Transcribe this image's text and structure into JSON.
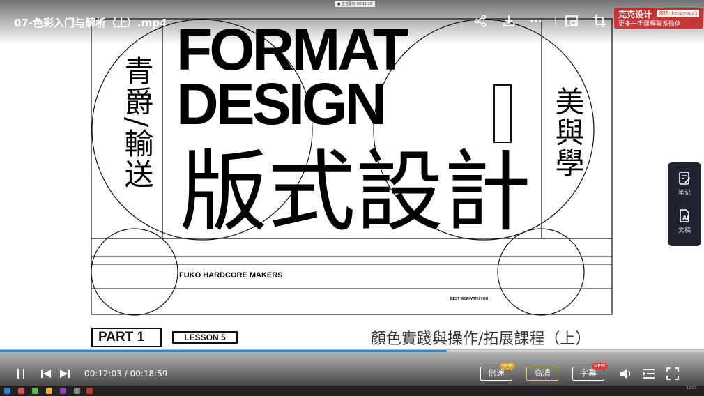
{
  "window": {
    "file_title": "07-色彩入门与解析（上）.mp4",
    "rec_tag": "● 正在录制 00:11:18"
  },
  "poster": {
    "title_line1": "FORMAT",
    "title_line2": "DESIGN",
    "left_vertical_text": "青爵/輸送",
    "right_vertical_text": "美與學",
    "big_chinese": "版式設計",
    "makers": "FUKO HARDCORE MAKERS",
    "wish": "BEST WISH WITH YOU",
    "part_label": "PART  1",
    "lesson_label": "LESSON  5",
    "subtitle": "顏色實踐與操作/拓展課程（上）"
  },
  "watermark": {
    "brand": "克克设计",
    "wechat": "微信: kekeyoya1",
    "slogan": "更多一手课程联系微信"
  },
  "top_icons": [
    "share-icon",
    "download-icon",
    "more-icon",
    "picture-in-picture-icon",
    "crop-icon",
    "minimize-icon",
    "maximize-icon",
    "close-icon"
  ],
  "side_panel": {
    "notes_label": "笔记",
    "transcript_label": "文稿"
  },
  "player": {
    "current_time": "00:12:03",
    "total_time": "00:18:59",
    "time_display": "00:12:03 / 00:18:59",
    "progress_fraction": 0.635,
    "speed_label": "倍速",
    "speed_badge": "SVIP",
    "quality_label": "高清",
    "subtitle_label": "字幕",
    "subtitle_badge": "NEW",
    "accent_color": "#1e88e5",
    "quality_border_color": "#f0c050",
    "svip_badge_color": "#e0a030",
    "new_badge_color": "#e53935"
  },
  "taskbar": {
    "clock": "12:03"
  }
}
